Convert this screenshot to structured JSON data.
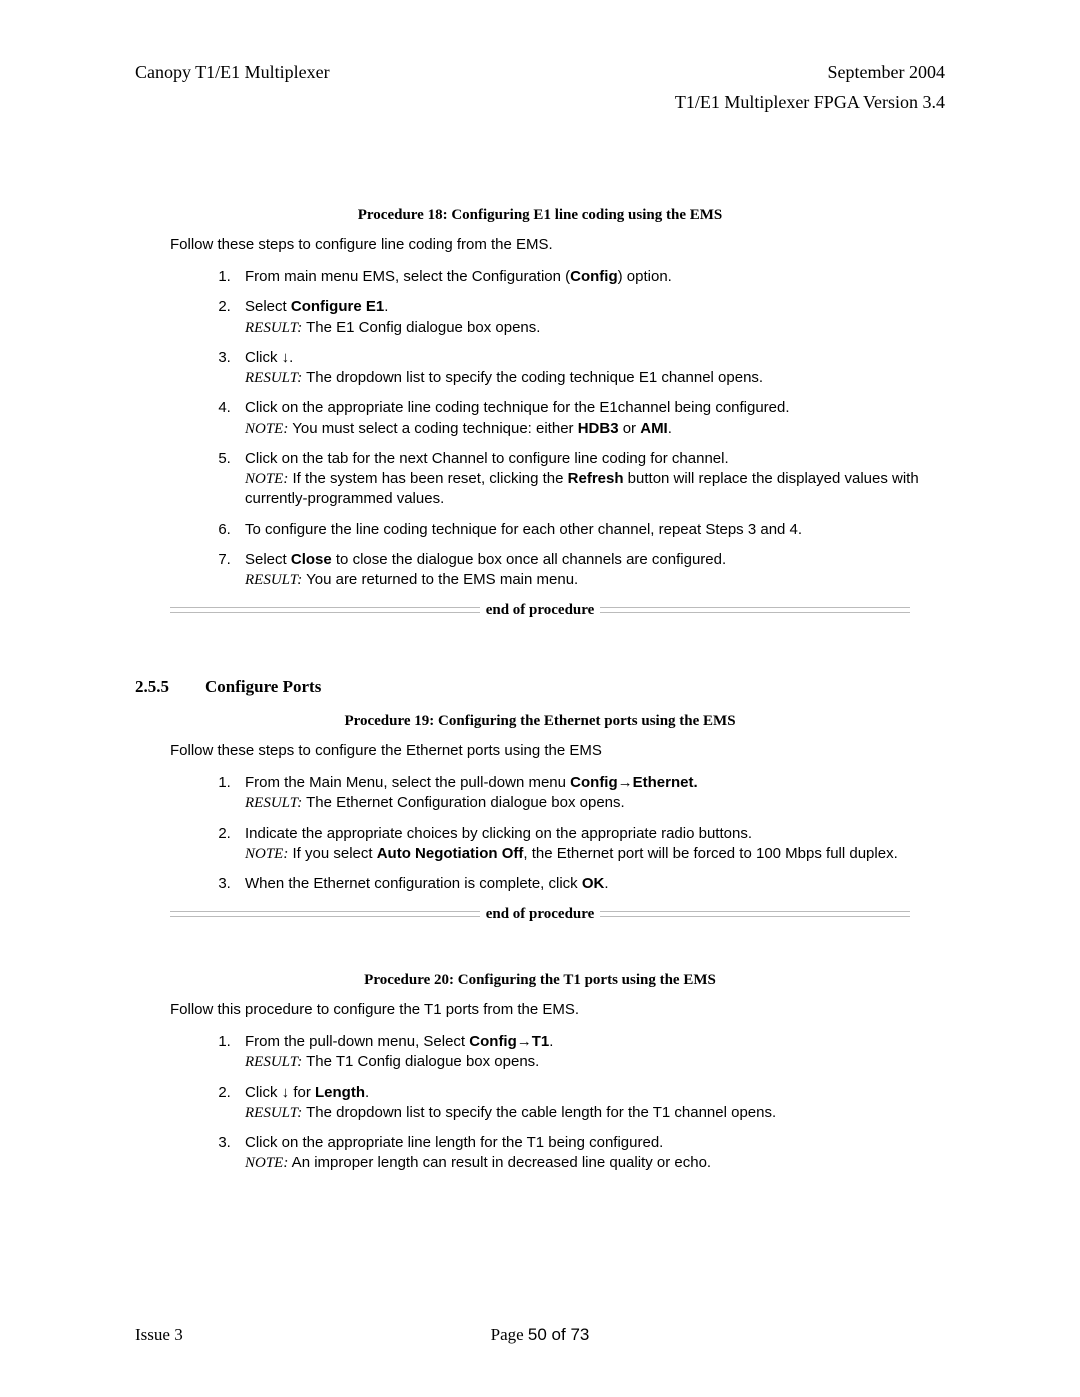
{
  "header": {
    "left": "Canopy T1/E1 Multiplexer",
    "right": "September 2004",
    "sub": "T1/E1 Multiplexer FPGA Version 3.4"
  },
  "proc18": {
    "title": "Procedure 18: Configuring E1 line coding using the EMS",
    "intro": "Follow these steps to configure line coding from the EMS.",
    "s1_a": "From main menu EMS, select the Configuration (",
    "s1_b": "Config",
    "s1_c": ") option.",
    "s2_a": "Select ",
    "s2_b": "Configure E1",
    "s2_c": ".",
    "s2_r": " The E1 Config dialogue box opens.",
    "s3_a": "Click ↓.",
    "s3_r": " The dropdown list to specify the coding technique E1 channel opens.",
    "s4_a": "Click on the appropriate line coding technique for the E1channel being configured.",
    "s4_n1": " You must select a coding technique: either ",
    "s4_b1": "HDB3",
    "s4_mid": " or ",
    "s4_b2": "AMI",
    "s4_end": ".",
    "s5_a": "Click on the tab for the next Channel to configure line coding for channel.",
    "s5_n1": " If the system has been reset, clicking the ",
    "s5_b": "Refresh",
    "s5_n2": " button will replace the displayed values with currently-programmed values.",
    "s6": "To configure the line coding technique for each other channel, repeat Steps 3 and 4.",
    "s7_a": "Select ",
    "s7_b": "Close",
    "s7_c": " to close the dialogue box once all channels are configured.",
    "s7_r": " You are returned to the EMS main menu."
  },
  "section": {
    "num": "2.5.5",
    "title": "Configure Ports"
  },
  "proc19": {
    "title": "Procedure 19: Configuring the Ethernet ports using the EMS",
    "intro": "Follow these steps to configure the Ethernet ports using the EMS",
    "s1_a": "From the Main Menu, select the pull-down menu ",
    "s1_b": "Config→Ethernet.",
    "s1_r": " The Ethernet Configuration dialogue box opens.",
    "s2_a": "Indicate the appropriate choices by clicking on the appropriate radio buttons.",
    "s2_n1": " If you select ",
    "s2_b": "Auto Negotiation Off",
    "s2_n2": ", the Ethernet port will be forced to 100 Mbps full duplex.",
    "s3_a": "When the Ethernet configuration is complete, click ",
    "s3_b": "OK",
    "s3_c": "."
  },
  "proc20": {
    "title": "Procedure 20: Configuring the T1 ports using the EMS",
    "intro": "Follow this procedure to configure the T1 ports from the EMS.",
    "s1_a": "From the pull-down menu, Select ",
    "s1_b": "Config→T1",
    "s1_c": ".",
    "s1_r": " The T1 Config dialogue box opens.",
    "s2_a": "Click ↓ for ",
    "s2_b": "Length",
    "s2_c": ".",
    "s2_r": " The dropdown list to specify the cable length for the T1 channel opens.",
    "s3_a": "Click on the appropriate line length for the T1 being configured.",
    "s3_n": " An improper length can result in decreased line quality or echo."
  },
  "labels": {
    "result": "RESULT:",
    "note": "NOTE:",
    "eop": "end of procedure"
  },
  "footer": {
    "left": "Issue 3",
    "center_a": "Page ",
    "center_b": "50 of 73"
  }
}
